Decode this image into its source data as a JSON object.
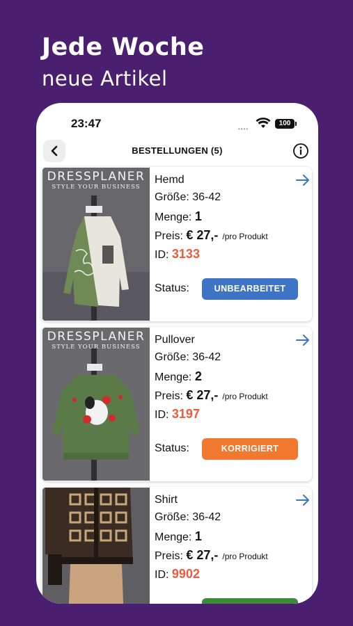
{
  "promo": {
    "title": "Jede Woche",
    "subtitle": "neue Artikel"
  },
  "status_bar": {
    "time": "23:47",
    "signal": "••••",
    "battery": "100"
  },
  "nav": {
    "title": "BESTELLUNGEN (5)",
    "back_icon": "chevron-left-icon",
    "info_icon": "info-icon"
  },
  "labels": {
    "size": "Größe:",
    "quantity": "Menge:",
    "price": "Preis:",
    "id": "ID:",
    "status": "Status:",
    "per_product": "/pro Produkt"
  },
  "watermark": {
    "brand": "DRESSPLANER",
    "tagline": "STYLE YOUR BUSINESS"
  },
  "orders": [
    {
      "name": "Hemd",
      "size": "36-42",
      "quantity": "1",
      "price": "€ 27,-",
      "id": "3133",
      "status": "UNBEARBEITET",
      "status_color": "#3d74c6"
    },
    {
      "name": "Pullover",
      "size": "36-42",
      "quantity": "2",
      "price": "€ 27,-",
      "id": "3197",
      "status": "KORRIGIERT",
      "status_color": "#f0792f"
    },
    {
      "name": "Shirt",
      "size": "36-42",
      "quantity": "1",
      "price": "€ 27,-",
      "id": "9902",
      "status": "",
      "status_color": "#3f8a3a"
    }
  ],
  "colors": {
    "background": "#4b1f6f",
    "accent_blue": "#3d74c6",
    "id_red": "#f05a3c"
  }
}
